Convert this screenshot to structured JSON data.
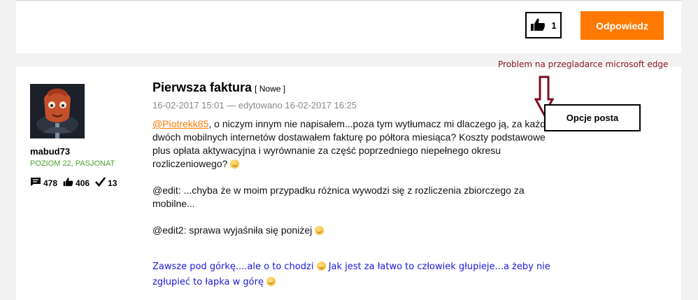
{
  "top_actions": {
    "kudos_count": "1",
    "reply_label": "Odpowiedz"
  },
  "author": {
    "username": "mabud73",
    "rank": "POZIOM 22, PASJONAT",
    "messages": "478",
    "kudos": "406",
    "solutions": "13"
  },
  "post": {
    "title": "Pierwsza faktura",
    "badge": "[ Nowe ]",
    "date": "16-02-2017 15:01 — edytowano 16-02-2017 16:25",
    "mention": "@Piotrekk85",
    "para1": ", o niczym innym nie napisałem...poza tym wytłumacz mi dlaczego ją, za każdy z dwóch mobilnych internetów dostawałem fakturę po półtora miesiąca? Koszty podstawowe plus opłata aktywacyjna i wyrównanie za część poprzedniego niepełnego okresu rozliczeniowego?",
    "para2": "@edit: ...chyba że w moim przypadku różnica wywodzi się z rozliczenia zbiorczego za mobilne...",
    "para3": "@edit2: sprawa wyjaśniła się poniżej",
    "signature_part1": "Zawsze pod górkę....ale o to chodzi",
    "signature_part2": " Jak jest za łatwo to człowiek głupieje...a żeby nie zgłupieć to łapka w górę"
  },
  "options_label": "Opcje posta",
  "annotation": "Problem na przegladarce microsoft edge",
  "colors": {
    "brand_orange": "#ff7900",
    "rank_green": "#4aa02c",
    "signature_blue": "#1a1ad8",
    "annotation_red": "#8b1a2a"
  }
}
